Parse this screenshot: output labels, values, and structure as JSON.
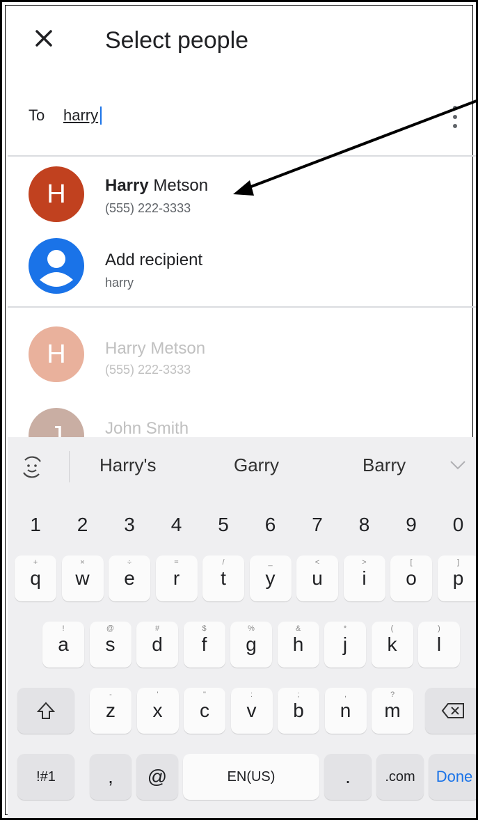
{
  "header": {
    "title": "Select people"
  },
  "to": {
    "label": "To",
    "value": "harry"
  },
  "suggestions": [
    {
      "name_bold": "Harry",
      "name_rest": " Metson",
      "sub": "(555) 222-3333",
      "avatar_letter": "H"
    },
    {
      "name_bold": "",
      "name_rest": "Add recipient",
      "sub": "harry",
      "avatar_letter": ""
    }
  ],
  "contacts": [
    {
      "name": "Harry Metson",
      "sub": "(555) 222-3333",
      "avatar_letter": "H"
    },
    {
      "name": "John Smith",
      "sub": "",
      "avatar_letter": "J"
    }
  ],
  "keyboard": {
    "suggestions": [
      "Harry's",
      "Garry",
      "Barry"
    ],
    "number_row": [
      "1",
      "2",
      "3",
      "4",
      "5",
      "6",
      "7",
      "8",
      "9",
      "0"
    ],
    "row1": [
      {
        "k": "q",
        "h": "+"
      },
      {
        "k": "w",
        "h": "×"
      },
      {
        "k": "e",
        "h": "÷"
      },
      {
        "k": "r",
        "h": "="
      },
      {
        "k": "t",
        "h": "/"
      },
      {
        "k": "y",
        "h": "_"
      },
      {
        "k": "u",
        "h": "<"
      },
      {
        "k": "i",
        "h": ">"
      },
      {
        "k": "o",
        "h": "["
      },
      {
        "k": "p",
        "h": "]"
      }
    ],
    "row2": [
      {
        "k": "a",
        "h": "!"
      },
      {
        "k": "s",
        "h": "@"
      },
      {
        "k": "d",
        "h": "#"
      },
      {
        "k": "f",
        "h": "$"
      },
      {
        "k": "g",
        "h": "%"
      },
      {
        "k": "h",
        "h": "&"
      },
      {
        "k": "j",
        "h": "*"
      },
      {
        "k": "k",
        "h": "("
      },
      {
        "k": "l",
        "h": ")"
      }
    ],
    "row3": [
      {
        "k": "z",
        "h": "-"
      },
      {
        "k": "x",
        "h": "'"
      },
      {
        "k": "c",
        "h": "\""
      },
      {
        "k": "v",
        "h": ":"
      },
      {
        "k": "b",
        "h": ";"
      },
      {
        "k": "n",
        "h": ","
      },
      {
        "k": "m",
        "h": "?"
      }
    ],
    "symbols_label": "!#1",
    "comma_label": ",",
    "at_label": "@",
    "space_label": "EN(US)",
    "period_label": ".",
    "com_label": ".com",
    "done_label": "Done"
  },
  "colors": {
    "accent": "#1a73e8",
    "avatar_red": "#c1411f",
    "avatar_blue": "#1a73e8"
  },
  "icons": [
    "close-icon",
    "more-vert-icon",
    "person-icon",
    "emoji-icon",
    "chevron-down-icon",
    "shift-icon",
    "backspace-icon"
  ]
}
